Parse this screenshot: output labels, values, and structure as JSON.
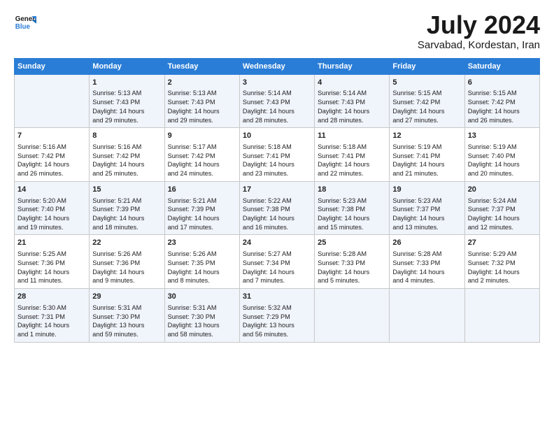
{
  "logo": {
    "line1": "General",
    "line2": "Blue"
  },
  "title": "July 2024",
  "subtitle": "Sarvabad, Kordestan, Iran",
  "headers": [
    "Sunday",
    "Monday",
    "Tuesday",
    "Wednesday",
    "Thursday",
    "Friday",
    "Saturday"
  ],
  "weeks": [
    [
      {
        "day": "",
        "info": ""
      },
      {
        "day": "1",
        "info": "Sunrise: 5:13 AM\nSunset: 7:43 PM\nDaylight: 14 hours\nand 29 minutes."
      },
      {
        "day": "2",
        "info": "Sunrise: 5:13 AM\nSunset: 7:43 PM\nDaylight: 14 hours\nand 29 minutes."
      },
      {
        "day": "3",
        "info": "Sunrise: 5:14 AM\nSunset: 7:43 PM\nDaylight: 14 hours\nand 28 minutes."
      },
      {
        "day": "4",
        "info": "Sunrise: 5:14 AM\nSunset: 7:43 PM\nDaylight: 14 hours\nand 28 minutes."
      },
      {
        "day": "5",
        "info": "Sunrise: 5:15 AM\nSunset: 7:42 PM\nDaylight: 14 hours\nand 27 minutes."
      },
      {
        "day": "6",
        "info": "Sunrise: 5:15 AM\nSunset: 7:42 PM\nDaylight: 14 hours\nand 26 minutes."
      }
    ],
    [
      {
        "day": "7",
        "info": "Sunrise: 5:16 AM\nSunset: 7:42 PM\nDaylight: 14 hours\nand 26 minutes."
      },
      {
        "day": "8",
        "info": "Sunrise: 5:16 AM\nSunset: 7:42 PM\nDaylight: 14 hours\nand 25 minutes."
      },
      {
        "day": "9",
        "info": "Sunrise: 5:17 AM\nSunset: 7:42 PM\nDaylight: 14 hours\nand 24 minutes."
      },
      {
        "day": "10",
        "info": "Sunrise: 5:18 AM\nSunset: 7:41 PM\nDaylight: 14 hours\nand 23 minutes."
      },
      {
        "day": "11",
        "info": "Sunrise: 5:18 AM\nSunset: 7:41 PM\nDaylight: 14 hours\nand 22 minutes."
      },
      {
        "day": "12",
        "info": "Sunrise: 5:19 AM\nSunset: 7:41 PM\nDaylight: 14 hours\nand 21 minutes."
      },
      {
        "day": "13",
        "info": "Sunrise: 5:19 AM\nSunset: 7:40 PM\nDaylight: 14 hours\nand 20 minutes."
      }
    ],
    [
      {
        "day": "14",
        "info": "Sunrise: 5:20 AM\nSunset: 7:40 PM\nDaylight: 14 hours\nand 19 minutes."
      },
      {
        "day": "15",
        "info": "Sunrise: 5:21 AM\nSunset: 7:39 PM\nDaylight: 14 hours\nand 18 minutes."
      },
      {
        "day": "16",
        "info": "Sunrise: 5:21 AM\nSunset: 7:39 PM\nDaylight: 14 hours\nand 17 minutes."
      },
      {
        "day": "17",
        "info": "Sunrise: 5:22 AM\nSunset: 7:38 PM\nDaylight: 14 hours\nand 16 minutes."
      },
      {
        "day": "18",
        "info": "Sunrise: 5:23 AM\nSunset: 7:38 PM\nDaylight: 14 hours\nand 15 minutes."
      },
      {
        "day": "19",
        "info": "Sunrise: 5:23 AM\nSunset: 7:37 PM\nDaylight: 14 hours\nand 13 minutes."
      },
      {
        "day": "20",
        "info": "Sunrise: 5:24 AM\nSunset: 7:37 PM\nDaylight: 14 hours\nand 12 minutes."
      }
    ],
    [
      {
        "day": "21",
        "info": "Sunrise: 5:25 AM\nSunset: 7:36 PM\nDaylight: 14 hours\nand 11 minutes."
      },
      {
        "day": "22",
        "info": "Sunrise: 5:26 AM\nSunset: 7:36 PM\nDaylight: 14 hours\nand 9 minutes."
      },
      {
        "day": "23",
        "info": "Sunrise: 5:26 AM\nSunset: 7:35 PM\nDaylight: 14 hours\nand 8 minutes."
      },
      {
        "day": "24",
        "info": "Sunrise: 5:27 AM\nSunset: 7:34 PM\nDaylight: 14 hours\nand 7 minutes."
      },
      {
        "day": "25",
        "info": "Sunrise: 5:28 AM\nSunset: 7:33 PM\nDaylight: 14 hours\nand 5 minutes."
      },
      {
        "day": "26",
        "info": "Sunrise: 5:28 AM\nSunset: 7:33 PM\nDaylight: 14 hours\nand 4 minutes."
      },
      {
        "day": "27",
        "info": "Sunrise: 5:29 AM\nSunset: 7:32 PM\nDaylight: 14 hours\nand 2 minutes."
      }
    ],
    [
      {
        "day": "28",
        "info": "Sunrise: 5:30 AM\nSunset: 7:31 PM\nDaylight: 14 hours\nand 1 minute."
      },
      {
        "day": "29",
        "info": "Sunrise: 5:31 AM\nSunset: 7:30 PM\nDaylight: 13 hours\nand 59 minutes."
      },
      {
        "day": "30",
        "info": "Sunrise: 5:31 AM\nSunset: 7:30 PM\nDaylight: 13 hours\nand 58 minutes."
      },
      {
        "day": "31",
        "info": "Sunrise: 5:32 AM\nSunset: 7:29 PM\nDaylight: 13 hours\nand 56 minutes."
      },
      {
        "day": "",
        "info": ""
      },
      {
        "day": "",
        "info": ""
      },
      {
        "day": "",
        "info": ""
      }
    ]
  ]
}
